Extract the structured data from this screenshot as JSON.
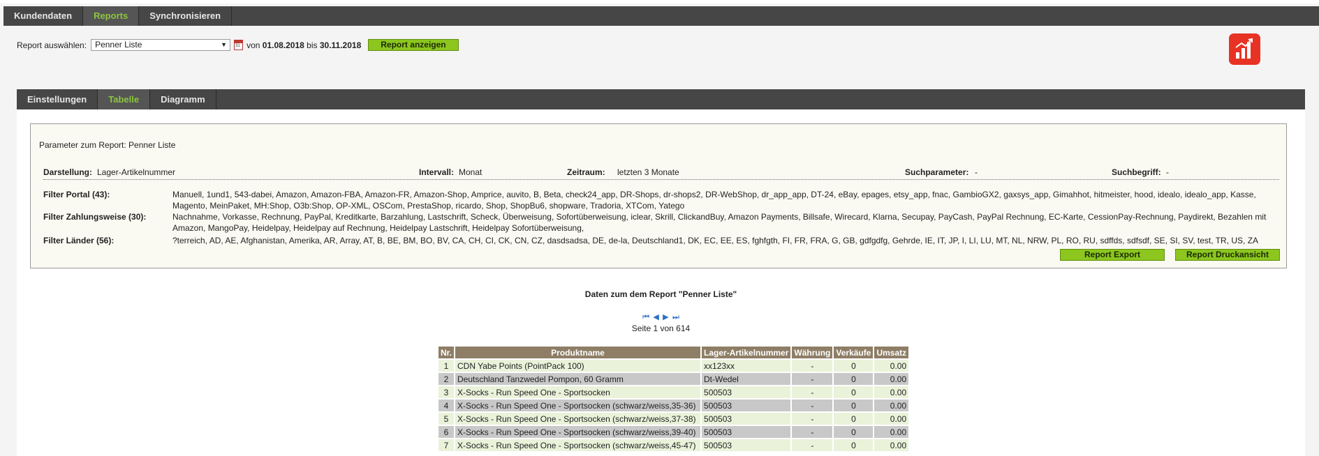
{
  "top_nav": {
    "tabs": [
      {
        "label": "Kundendaten"
      },
      {
        "label": "Reports"
      },
      {
        "label": "Synchronisieren"
      }
    ],
    "active": "Reports"
  },
  "report_select": {
    "label": "Report auswählen:",
    "selected": "Penner Liste",
    "von_text": "von",
    "date_from": "01.08.2018",
    "bis_text": "bis",
    "date_to": "30.11.2018",
    "show_button": "Report anzeigen"
  },
  "sub_nav": {
    "tabs": [
      {
        "label": "Einstellungen"
      },
      {
        "label": "Tabelle"
      },
      {
        "label": "Diagramm"
      }
    ],
    "active": "Tabelle"
  },
  "parameters": {
    "title": "Parameter zum Report: Penner Liste",
    "darstellung_label": "Darstellung:",
    "darstellung_value": "Lager-Artikelnummer",
    "intervall_label": "Intervall:",
    "intervall_value": "Monat",
    "zeitraum_label": "Zeitraum:",
    "zeitraum_value": "letzten 3 Monate",
    "suchparameter_label": "Suchparameter:",
    "suchparameter_value": "-",
    "suchbegriff_label": "Suchbegriff:",
    "suchbegriff_value": "-",
    "filter_portal_label": "Filter Portal (43):",
    "filter_portal_value": "Manuell, 1und1, 543-dabei, Amazon, Amazon-FBA, Amazon-FR, Amazon-Shop, Amprice, auvito, B, Beta, check24_app, DR-Shops, dr-shops2, DR-WebShop, dr_app_app, DT-24, eBay, epages, etsy_app, fnac, GambioGX2, gaxsys_app, Gimahhot, hitmeister, hood, idealo, idealo_app, Kasse, Magento, MeinPaket, MH:Shop, O3b:Shop, OP-XML, OSCom, PrestaShop, ricardo, Shop, ShopBu6, shopware, Tradoria, XTCom, Yatego",
    "filter_zahlung_label": "Filter Zahlungsweise (30):",
    "filter_zahlung_value": "Nachnahme, Vorkasse, Rechnung, PayPal, Kreditkarte, Barzahlung, Lastschrift, Scheck, Überweisung, Sofortüberweisung, iclear, Skrill, ClickandBuy, Amazon Payments, Billsafe, Wirecard, Klarna, Secupay, PayCash, PayPal Rechnung, EC-Karte, CessionPay-Rechnung, Paydirekt, Bezahlen mit Amazon, MangoPay, Heidelpay, Heidelpay auf Rechnung, Heidelpay Lastschrift, Heidelpay Sofortüberweisung,",
    "filter_laender_label": "Filter Länder (56):",
    "filter_laender_value": "?terreich, AD, AE, Afghanistan, Amerika, AR, Array, AT, B, BE, BM, BO, BV, CA, CH, CI, CK, CN, CZ, dasdsadsa, DE, de-la, Deutschland1, DK, EC, EE, ES, fghfgth, FI, FR, FRA, G, GB, gdfgdfg, Gehrde, IE, IT, JP, I, LI, LU, MT, NL, NRW, PL, RO, RU, sdffds, sdfsdf, SE, SI, SV, test, TR, US, ZA",
    "export_button": "Report Export",
    "print_button": "Report Druckansicht"
  },
  "data_section": {
    "title": "Daten zum dem Report \"Penner Liste\"",
    "page_text": "Seite 1 von 614"
  },
  "table": {
    "headers": {
      "nr": "Nr.",
      "produkt": "Produktname",
      "lager": "Lager-Artikelnummer",
      "waehrung": "Währung",
      "verkaeufe": "Verkäufe",
      "umsatz": "Umsatz"
    },
    "rows": [
      {
        "nr": "1",
        "produkt": "CDN Yabe Points (PointPack 100)",
        "lager": "xx123xx",
        "waehrung": "-",
        "verkaeufe": "0",
        "umsatz": "0.00"
      },
      {
        "nr": "2",
        "produkt": "Deutschland Tanzwedel Pompon, 60 Gramm",
        "lager": "Dt-Wedel",
        "waehrung": "-",
        "verkaeufe": "0",
        "umsatz": "0.00"
      },
      {
        "nr": "3",
        "produkt": "X-Socks - Run Speed One - Sportsocken",
        "lager": "500503",
        "waehrung": "-",
        "verkaeufe": "0",
        "umsatz": "0.00"
      },
      {
        "nr": "4",
        "produkt": "X-Socks - Run Speed One - Sportsocken (schwarz/weiss,35-36)",
        "lager": "500503",
        "waehrung": "-",
        "verkaeufe": "0",
        "umsatz": "0.00"
      },
      {
        "nr": "5",
        "produkt": "X-Socks - Run Speed One - Sportsocken (schwarz/weiss,37-38)",
        "lager": "500503",
        "waehrung": "-",
        "verkaeufe": "0",
        "umsatz": "0.00"
      },
      {
        "nr": "6",
        "produkt": "X-Socks - Run Speed One - Sportsocken (schwarz/weiss,39-40)",
        "lager": "500503",
        "waehrung": "-",
        "verkaeufe": "0",
        "umsatz": "0.00"
      },
      {
        "nr": "7",
        "produkt": "X-Socks - Run Speed One - Sportsocken (schwarz/weiss,45-47)",
        "lager": "500503",
        "waehrung": "-",
        "verkaeufe": "0",
        "umsatz": "0.00"
      }
    ]
  },
  "icons": {
    "calendar": "calendar-icon",
    "report": "bar-chart-icon",
    "pager": [
      "first-page-icon",
      "prev-page-icon",
      "next-page-icon",
      "last-page-icon"
    ]
  },
  "colors": {
    "nav_bg": "#464646",
    "active_tab_text": "#8cc63f",
    "button_green": "#8cc61e",
    "report_icon": "#e83324",
    "table_header": "#8e7e66",
    "row_odd": "#eaf2da",
    "row_even": "#c8c8c8"
  }
}
